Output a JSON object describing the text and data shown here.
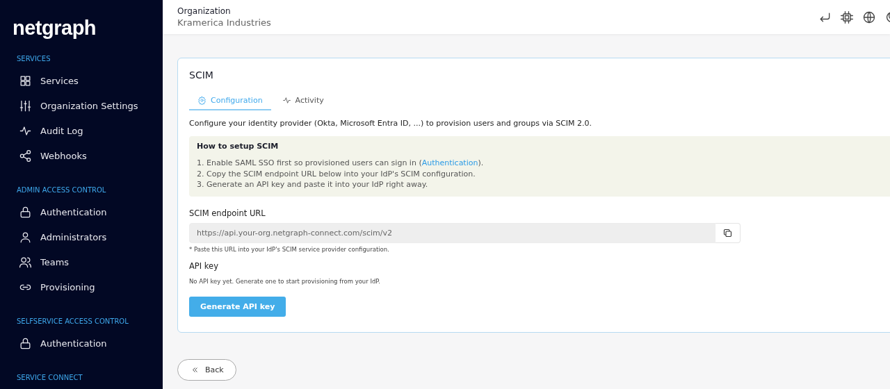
{
  "sidebar": {
    "logo": "netgraph",
    "sections": [
      {
        "title": "SERVICES",
        "items": [
          {
            "label": "Services",
            "kind": "grid",
            "selected": false
          },
          {
            "label": "Organization Settings",
            "kind": "sliders",
            "selected": false
          },
          {
            "label": "Audit Log",
            "kind": "pulse",
            "selected": false
          },
          {
            "label": "Webhooks",
            "kind": "share",
            "selected": false
          }
        ]
      },
      {
        "title": "ADMIN ACCESS CONTROL",
        "items": [
          {
            "label": "Authentication",
            "kind": "lock",
            "selected": false
          },
          {
            "label": "Administrators",
            "kind": "user",
            "selected": false
          },
          {
            "label": "Teams",
            "kind": "users",
            "selected": false
          },
          {
            "label": "Provisioning",
            "kind": "link",
            "selected": false
          }
        ]
      },
      {
        "title": "SELFSERVICE ACCESS CONTROL",
        "items": [
          {
            "label": "Authentication",
            "kind": "lock",
            "selected": false
          }
        ]
      },
      {
        "title": "SERVICE CONNECT"
      }
    ]
  },
  "header": {
    "label": "Organization",
    "value": "Kramerica Industries"
  },
  "card": {
    "title": "SCIM",
    "tabs": [
      {
        "label": "Configuration",
        "kind": "gear",
        "selected": true
      },
      {
        "label": "Activity",
        "kind": "pulse",
        "selected": false
      }
    ],
    "intro": "Configure your identity provider (Okta, Microsoft Entra ID, ...) to provision users and groups via SCIM 2.0.",
    "howto": {
      "title": "How to setup SCIM",
      "steps": [
        {
          "before": "1. Enable SAML SSO first so provisioned users can sign in (",
          "link": "Authentication",
          "after": ")."
        },
        {
          "before": "2. Copy the SCIM endpoint URL below into your IdP's SCIM configuration."
        },
        {
          "before": "3. Generate an API key and paste it into your IdP right away."
        }
      ]
    },
    "endpoint": {
      "label": "SCIM endpoint URL",
      "value": "https://api.your-org.netgraph-connect.com/scim/v2",
      "hint": "* Paste this URL into your IdP's SCIM service provider configuration."
    },
    "api_key": {
      "label": "API key",
      "note": "No API key yet. Generate one to start provisioning from your IdP.",
      "button": "Generate API key"
    }
  },
  "back_button": "Back"
}
